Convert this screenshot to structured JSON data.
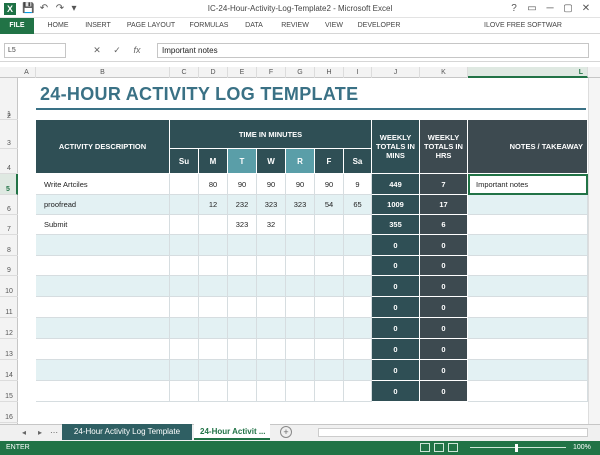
{
  "window": {
    "title": "IC-24-Hour-Activity-Log-Template2 - Microsoft Excel",
    "app_letter": "X",
    "user": "ILOVE FREE SOFTWAR",
    "controls": [
      "?",
      "▭",
      "─",
      "▢",
      "✕"
    ]
  },
  "quick_access": [
    "💾",
    "↶",
    "↷",
    "▾"
  ],
  "ribbon_tabs": [
    "FILE",
    "HOME",
    "INSERT",
    "PAGE LAYOUT",
    "FORMULAS",
    "DATA",
    "REVIEW",
    "VIEW",
    "DEVELOPER"
  ],
  "formula_bar": {
    "name_box": "L5",
    "icons": [
      "✕",
      "✓",
      "fx"
    ],
    "value": "Important notes"
  },
  "columns": [
    "A",
    "B",
    "C",
    "D",
    "E",
    "F",
    "G",
    "H",
    "I",
    "J",
    "K",
    "L"
  ],
  "rows": [
    "1",
    "2",
    "3",
    "4",
    "5",
    "6",
    "7",
    "8",
    "9",
    "10",
    "11",
    "12",
    "13",
    "14",
    "15",
    "16"
  ],
  "sheet": {
    "title": "24-HOUR ACTIVITY LOG TEMPLATE",
    "headers": {
      "activity": "ACTIVITY DESCRIPTION",
      "time": "TIME IN MINUTES",
      "days": [
        "Su",
        "M",
        "T",
        "W",
        "R",
        "F",
        "Sa"
      ],
      "weekly_mins": "WEEKLY TOTALS IN MINS",
      "weekly_hrs": "WEEKLY TOTALS IN HRS",
      "notes": "NOTES / TAKEAWAY"
    },
    "data_rows": [
      {
        "activity": "Write Artciles",
        "days": [
          "",
          "80",
          "90",
          "90",
          "90",
          "90",
          "9"
        ],
        "mins": "449",
        "hrs": "7",
        "notes": "Important notes"
      },
      {
        "activity": "proofread",
        "days": [
          "",
          "12",
          "232",
          "323",
          "323",
          "54",
          "65"
        ],
        "mins": "1009",
        "hrs": "17",
        "notes": ""
      },
      {
        "activity": "Submit",
        "days": [
          "",
          "",
          "323",
          "32",
          "",
          "",
          ""
        ],
        "mins": "355",
        "hrs": "6",
        "notes": ""
      },
      {
        "activity": "",
        "days": [
          "",
          "",
          "",
          "",
          "",
          "",
          ""
        ],
        "mins": "0",
        "hrs": "0",
        "notes": ""
      },
      {
        "activity": "",
        "days": [
          "",
          "",
          "",
          "",
          "",
          "",
          ""
        ],
        "mins": "0",
        "hrs": "0",
        "notes": ""
      },
      {
        "activity": "",
        "days": [
          "",
          "",
          "",
          "",
          "",
          "",
          ""
        ],
        "mins": "0",
        "hrs": "0",
        "notes": ""
      },
      {
        "activity": "",
        "days": [
          "",
          "",
          "",
          "",
          "",
          "",
          ""
        ],
        "mins": "0",
        "hrs": "0",
        "notes": ""
      },
      {
        "activity": "",
        "days": [
          "",
          "",
          "",
          "",
          "",
          "",
          ""
        ],
        "mins": "0",
        "hrs": "0",
        "notes": ""
      },
      {
        "activity": "",
        "days": [
          "",
          "",
          "",
          "",
          "",
          "",
          ""
        ],
        "mins": "0",
        "hrs": "0",
        "notes": ""
      },
      {
        "activity": "",
        "days": [
          "",
          "",
          "",
          "",
          "",
          "",
          ""
        ],
        "mins": "0",
        "hrs": "0",
        "notes": ""
      },
      {
        "activity": "",
        "days": [
          "",
          "",
          "",
          "",
          "",
          "",
          ""
        ],
        "mins": "0",
        "hrs": "0",
        "notes": ""
      }
    ]
  },
  "sheet_tabs": [
    "24-Hour Activity Log Template",
    "24-Hour Activit ..."
  ],
  "nav_arrows": [
    "◂",
    "▸",
    "⋯"
  ],
  "add_sheet": "+",
  "status": {
    "mode": "ENTER",
    "zoom": "100%"
  },
  "colors": {
    "accent": "#217346",
    "header": "#2f4f55",
    "title": "#3a7185"
  }
}
